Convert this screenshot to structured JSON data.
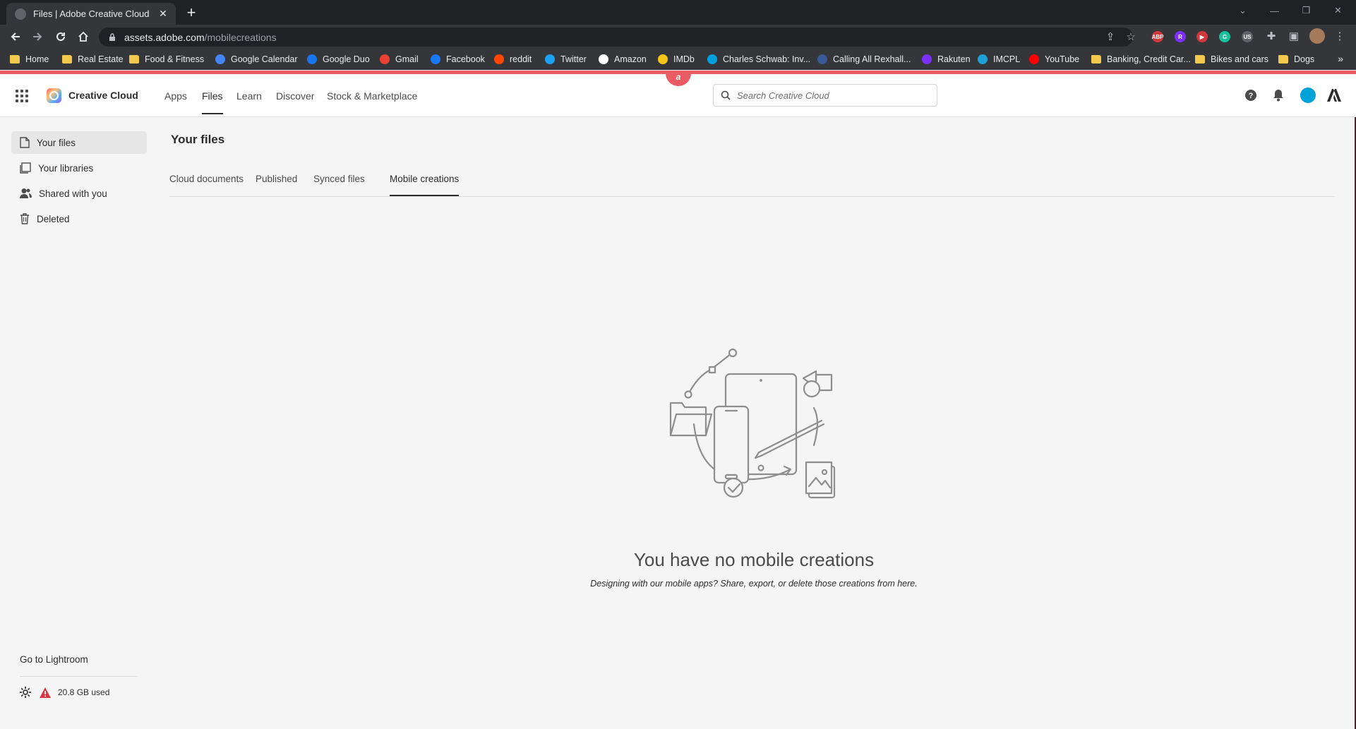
{
  "browser": {
    "tab_title": "Files | Adobe Creative Cloud",
    "tab_close": "✕",
    "new_tab": "+",
    "url_domain": "assets.adobe.com",
    "url_path": "/mobilecreations",
    "bookmarks": [
      {
        "label": "Home",
        "icon": "folder-icon",
        "color": "#f2c94c"
      },
      {
        "label": "Real Estate",
        "icon": "folder-icon",
        "color": "#f2c94c"
      },
      {
        "label": "Food & Fitness",
        "icon": "folder-icon",
        "color": "#f2c94c"
      },
      {
        "label": "Google Calendar",
        "icon": "calendar-icon",
        "color": "#4285f4"
      },
      {
        "label": "Google Duo",
        "icon": "duo-icon",
        "color": "#1a73e8"
      },
      {
        "label": "Gmail",
        "icon": "gmail-icon",
        "color": "#ea4335"
      },
      {
        "label": "Facebook",
        "icon": "facebook-icon",
        "color": "#1877f2"
      },
      {
        "label": "reddit",
        "icon": "reddit-icon",
        "color": "#ff4500"
      },
      {
        "label": "Twitter",
        "icon": "twitter-icon",
        "color": "#1da1f2"
      },
      {
        "label": "Amazon",
        "icon": "amazon-icon",
        "color": "#ffffff"
      },
      {
        "label": "IMDb",
        "icon": "imdb-icon",
        "color": "#f5c518"
      },
      {
        "label": "Charles Schwab: Inv...",
        "icon": "schwab-icon",
        "color": "#00a0df"
      },
      {
        "label": "Calling All Rexhall...",
        "icon": "rexhall-icon",
        "color": "#3b5998"
      },
      {
        "label": "Rakuten",
        "icon": "rakuten-icon",
        "color": "#7b2ff7"
      },
      {
        "label": "IMCPL",
        "icon": "imcpl-icon",
        "color": "#1ea0d8"
      },
      {
        "label": "YouTube",
        "icon": "youtube-icon",
        "color": "#ff0000"
      },
      {
        "label": "Banking, Credit Car...",
        "icon": "folder-icon",
        "color": "#f2c94c"
      },
      {
        "label": "Bikes and cars",
        "icon": "folder-icon",
        "color": "#f2c94c"
      },
      {
        "label": "Dogs",
        "icon": "folder-icon",
        "color": "#f2c94c"
      }
    ],
    "bookmarks_more": "»",
    "extensions": [
      {
        "name": "abp-icon",
        "text": "ABP",
        "color": "#d1383d"
      },
      {
        "name": "rakuten-ext-icon",
        "text": "R",
        "color": "#7b2ff7"
      },
      {
        "name": "play-ext-icon",
        "text": "▶",
        "color": "#d1383d"
      },
      {
        "name": "grammarly-icon",
        "text": "G",
        "color": "#15c39a"
      },
      {
        "name": "translate-ext-icon",
        "text": "US",
        "color": "#5f6368"
      }
    ]
  },
  "header": {
    "brand": "Creative Cloud",
    "nav": [
      "Apps",
      "Files",
      "Learn",
      "Discover",
      "Stock & Marketplace"
    ],
    "active_nav": "Files",
    "search_placeholder": "Search Creative Cloud",
    "accent_color": "#eb5b64"
  },
  "sidebar": {
    "items": [
      {
        "label": "Your files",
        "icon": "file-icon"
      },
      {
        "label": "Your libraries",
        "icon": "library-icon"
      },
      {
        "label": "Shared with you",
        "icon": "people-icon"
      },
      {
        "label": "Deleted",
        "icon": "trash-icon"
      }
    ],
    "go_to": "Go to Lightroom",
    "storage": "20.8 GB used"
  },
  "main": {
    "title": "Your files",
    "tabs": [
      "Cloud documents",
      "Published",
      "Synced files",
      "Mobile creations"
    ],
    "active_tab": "Mobile creations",
    "empty_title": "You have no mobile creations",
    "empty_subtitle": "Designing with our mobile apps? Share, export, or delete those creations from here."
  }
}
